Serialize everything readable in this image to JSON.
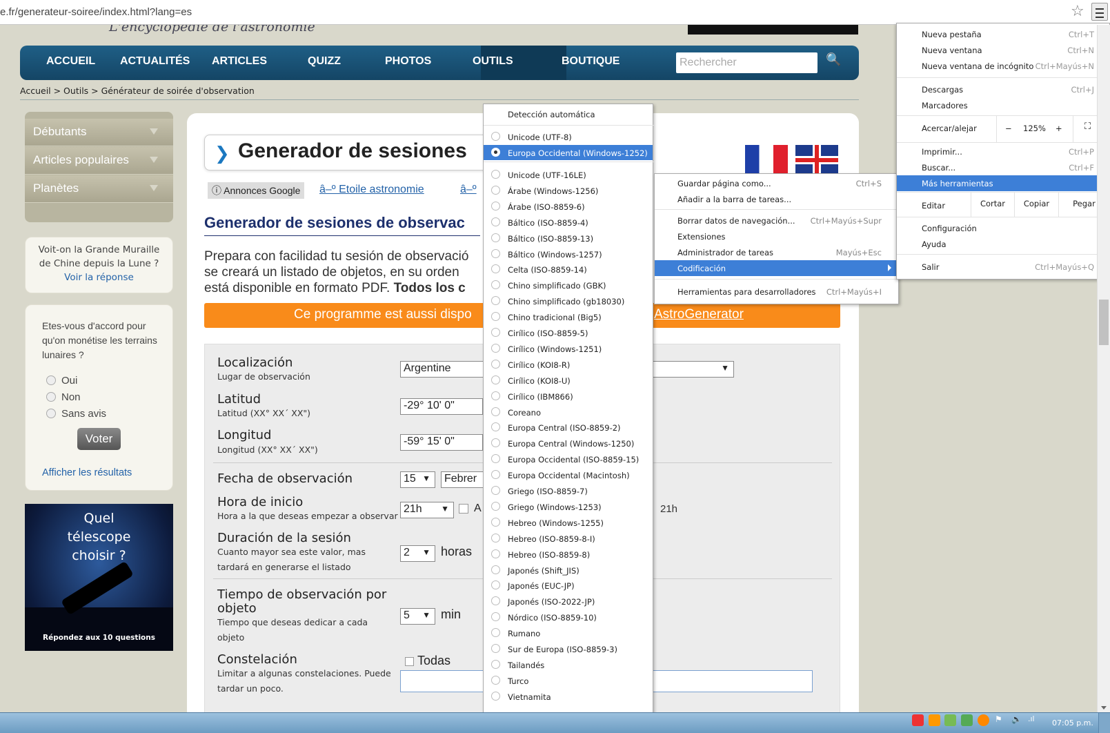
{
  "browser": {
    "url": "e.fr/generateur-soiree/index.html?lang=es",
    "bookmark_star": "☆"
  },
  "site": {
    "tagline": "L'encyclopédie de l'astronomie",
    "nav": [
      "ACCUEIL",
      "ACTUALITÉS",
      "ARTICLES",
      "QUIZZ",
      "PHOTOS",
      "OUTILS",
      "BOUTIQUE"
    ],
    "search_placeholder": "Rechercher",
    "breadcrumb": "Accueil > Outils > Générateur de soirée d'observation"
  },
  "sidebar": {
    "menu": [
      "Débutants",
      "Articles populaires",
      "Planètes"
    ],
    "muraille_question": "Voit-on la Grande Muraille de Chine depuis la Lune ?",
    "muraille_link": "Voir la réponse",
    "poll_question": "Etes-vous d'accord pour qu'on monétise les terrains lunaires ?",
    "poll_options": [
      "Oui",
      "Non",
      "Sans avis"
    ],
    "poll_button": "Voter",
    "poll_results": "Afficher les résultats",
    "telescope_title": "Quel télescope choisir ?",
    "telescope_sub": "Répondez aux 10 questions"
  },
  "main": {
    "title": "Generador de sesiones",
    "ads_label": "ⓘ Annonces Google",
    "ad_link_1": "â–º Etoile astronomie",
    "ad_link_2": "â–º",
    "heading": "Generador de sesiones de observac",
    "intro_line1": "Prepara con facilidad tu sesión de observació",
    "intro_line2": "se creará un listado de objetos, en su orden",
    "intro_line3a": "está disponible en formato PDF. ",
    "intro_line3b": "Todos los c",
    "banner_left": "Ce programme est aussi dispo",
    "banner_right": "AstroGenerator"
  },
  "form": {
    "loc_label": "Localización",
    "loc_sub": "Lugar de observación",
    "loc_value": "Argentine",
    "lat_label": "Latitud",
    "lat_sub": "Latitud (XX° XX´ XX\")",
    "lat_value": "-29° 10' 0\"",
    "lon_label": "Longitud",
    "lon_sub": "Longitud (XX° XX´ XX\")",
    "lon_value": "-59° 15' 0\"",
    "date_label": "Fecha de observación",
    "date_day": "15",
    "date_month": "Febrer",
    "hour_label": "Hora de inicio",
    "hour_sub": "Hora a la que deseas empezar a observar",
    "hour_value": "21h",
    "hour_checkbox_label": "A",
    "hour_right": "21h",
    "dur_label": "Duración de la sesión",
    "dur_sub1": "Cuanto mayor sea este valor, mas",
    "dur_sub2": "tardará en generarse el listado",
    "dur_value": "2",
    "dur_unit": "horas",
    "obj_label1": "Tiempo de observación por",
    "obj_label2": "objeto",
    "obj_sub1": "Tiempo que deseas dedicar a cada",
    "obj_sub2": "objeto",
    "obj_value": "5",
    "obj_unit": "min",
    "const_label": "Constelación",
    "const_sub1": "Limitar a algunas constelaciones. Puede",
    "const_sub2": "tardar un poco.",
    "const_check": "Todas"
  },
  "encoding_menu": {
    "auto": "Detección automática",
    "group1": [
      "Unicode (UTF-8)",
      "Europa Occidental (Windows-1252)"
    ],
    "selected_index": 1,
    "group2": [
      "Unicode (UTF-16LE)",
      "Árabe (Windows-1256)",
      "Árabe (ISO-8859-6)",
      "Báltico (ISO-8859-4)",
      "Báltico (ISO-8859-13)",
      "Báltico (Windows-1257)",
      "Celta (ISO-8859-14)",
      "Chino simplificado (GBK)",
      "Chino simplificado (gb18030)",
      "Chino tradicional (Big5)",
      "Cirílico (ISO-8859-5)",
      "Cirílico (Windows-1251)",
      "Cirílico (KOI8-R)",
      "Cirílico (KOI8-U)",
      "Cirílico (IBM866)",
      "Coreano",
      "Europa Central (ISO-8859-2)",
      "Europa Central (Windows-1250)",
      "Europa Occidental (ISO-8859-15)",
      "Europa Occidental (Macintosh)",
      "Griego (ISO-8859-7)",
      "Griego (Windows-1253)",
      "Hebreo (Windows-1255)",
      "Hebreo (ISO-8859-8-I)",
      "Hebreo (ISO-8859-8)",
      "Japonés (Shift_JIS)",
      "Japonés (EUC-JP)",
      "Japonés (ISO-2022-JP)",
      "Nórdico (ISO-8859-10)",
      "Rumano",
      "Sur de Europa (ISO-8859-3)",
      "Tailandés",
      "Turco",
      "Vietnamita"
    ]
  },
  "tools_menu": [
    {
      "label": "Guardar página como...",
      "shortcut": "Ctrl+S"
    },
    {
      "label": "Añadir a la barra de tareas...",
      "shortcut": ""
    },
    {
      "label": "Borrar datos de navegación...",
      "shortcut": "Ctrl+Mayús+Supr"
    },
    {
      "label": "Extensiones",
      "shortcut": ""
    },
    {
      "label": "Administrador de tareas",
      "shortcut": "Mayús+Esc"
    },
    {
      "label": "Codificación",
      "shortcut": ""
    },
    {
      "label": "Herramientas para desarrolladores",
      "shortcut": "Ctrl+Mayús+I"
    }
  ],
  "chrome_menu": {
    "new_tab": "Nueva pestaña",
    "new_tab_sc": "Ctrl+T",
    "new_window": "Nueva ventana",
    "new_window_sc": "Ctrl+N",
    "incognito": "Nueva ventana de incógnito",
    "incognito_sc": "Ctrl+Mayús+N",
    "downloads": "Descargas",
    "downloads_sc": "Ctrl+J",
    "bookmarks": "Marcadores",
    "zoom_label": "Acercar/alejar",
    "zoom_minus": "−",
    "zoom_value": "125%",
    "zoom_plus": "+",
    "fullscreen": "⛶",
    "print": "Imprimir...",
    "print_sc": "Ctrl+P",
    "find": "Buscar...",
    "find_sc": "Ctrl+F",
    "more_tools": "Más herramientas",
    "edit": "Editar",
    "cut": "Cortar",
    "copy": "Copiar",
    "paste": "Pegar",
    "settings": "Configuración",
    "help": "Ayuda",
    "exit": "Salir",
    "exit_sc": "Ctrl+Mayús+Q"
  },
  "taskbar": {
    "clock": "07:05 p.m."
  }
}
